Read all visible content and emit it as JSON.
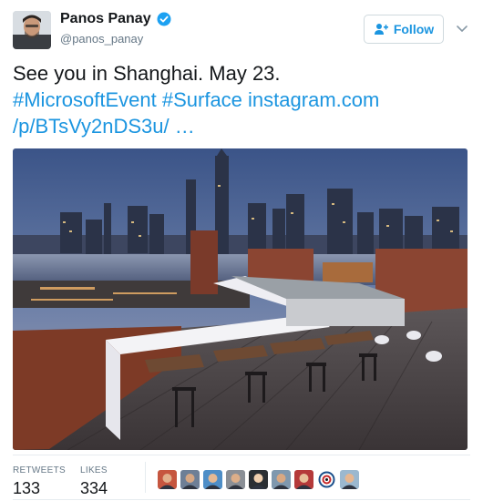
{
  "author": {
    "name": "Panos Panay",
    "handle": "@panos_panay",
    "verified": true,
    "avatar_icon": "profile-photo"
  },
  "follow_button": {
    "label": "Follow",
    "icon": "add-person-icon"
  },
  "menu_icon": "chevron-down-icon",
  "tweet": {
    "line1": "See you in Shanghai. May 23.",
    "hashtag1": "#MicrosoftEvent",
    "hashtag2": "#Surface",
    "link": "instagram.com /p/BTsVy2nDS3u/ …"
  },
  "media": {
    "icon": "photo-rooftop-shanghai-skyline"
  },
  "stats": {
    "retweets_label": "RETWEETS",
    "retweets_value": "133",
    "likes_label": "LIKES",
    "likes_value": "334"
  },
  "likers": [
    {
      "color": "#c6563f",
      "skin": "#e2b08c"
    },
    {
      "color": "#6e7f96",
      "skin": "#d6a784"
    },
    {
      "color": "#4e8ec7",
      "skin": "#e4b994"
    },
    {
      "color": "#8a8f96",
      "skin": "#dcae89"
    },
    {
      "color": "#2b2f33",
      "skin": "#f0cfae"
    },
    {
      "color": "#7f98ae",
      "skin": "#d9a882"
    },
    {
      "color": "#b53a3a",
      "skin": "#e8c09a"
    },
    {
      "color": "#ffffff",
      "skin": "target"
    },
    {
      "color": "#9bb8cf",
      "skin": "#e6b690"
    }
  ],
  "colors": {
    "accent": "#1b95e0",
    "verified": "#1da1f2",
    "muted": "#657786"
  }
}
